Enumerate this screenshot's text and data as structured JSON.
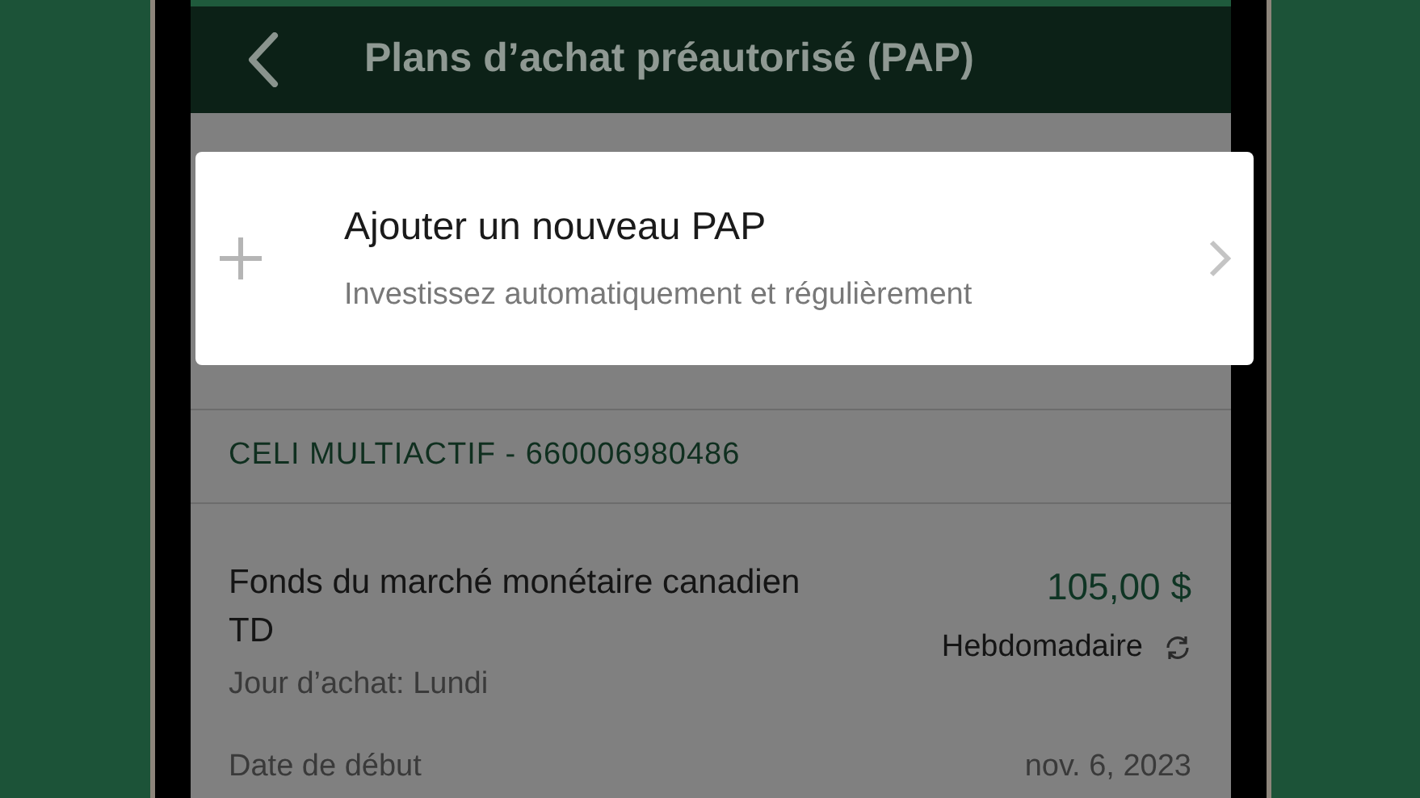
{
  "header": {
    "title": "Plans d’achat préautorisé (PAP)"
  },
  "add_card": {
    "title": "Ajouter un nouveau PAP",
    "subtitle": "Investissez automatiquement et régulièrement"
  },
  "account": {
    "label": "CELI MULTIACTIF - 660006980486"
  },
  "plan": {
    "fund": "Fonds du marché monétaire canadien TD",
    "purchase_day": "Jour d’achat: Lundi",
    "amount": "105,00 $",
    "frequency": "Hebdomadaire",
    "start_label": "Date de début",
    "start_date": "nov. 6, 2023"
  }
}
